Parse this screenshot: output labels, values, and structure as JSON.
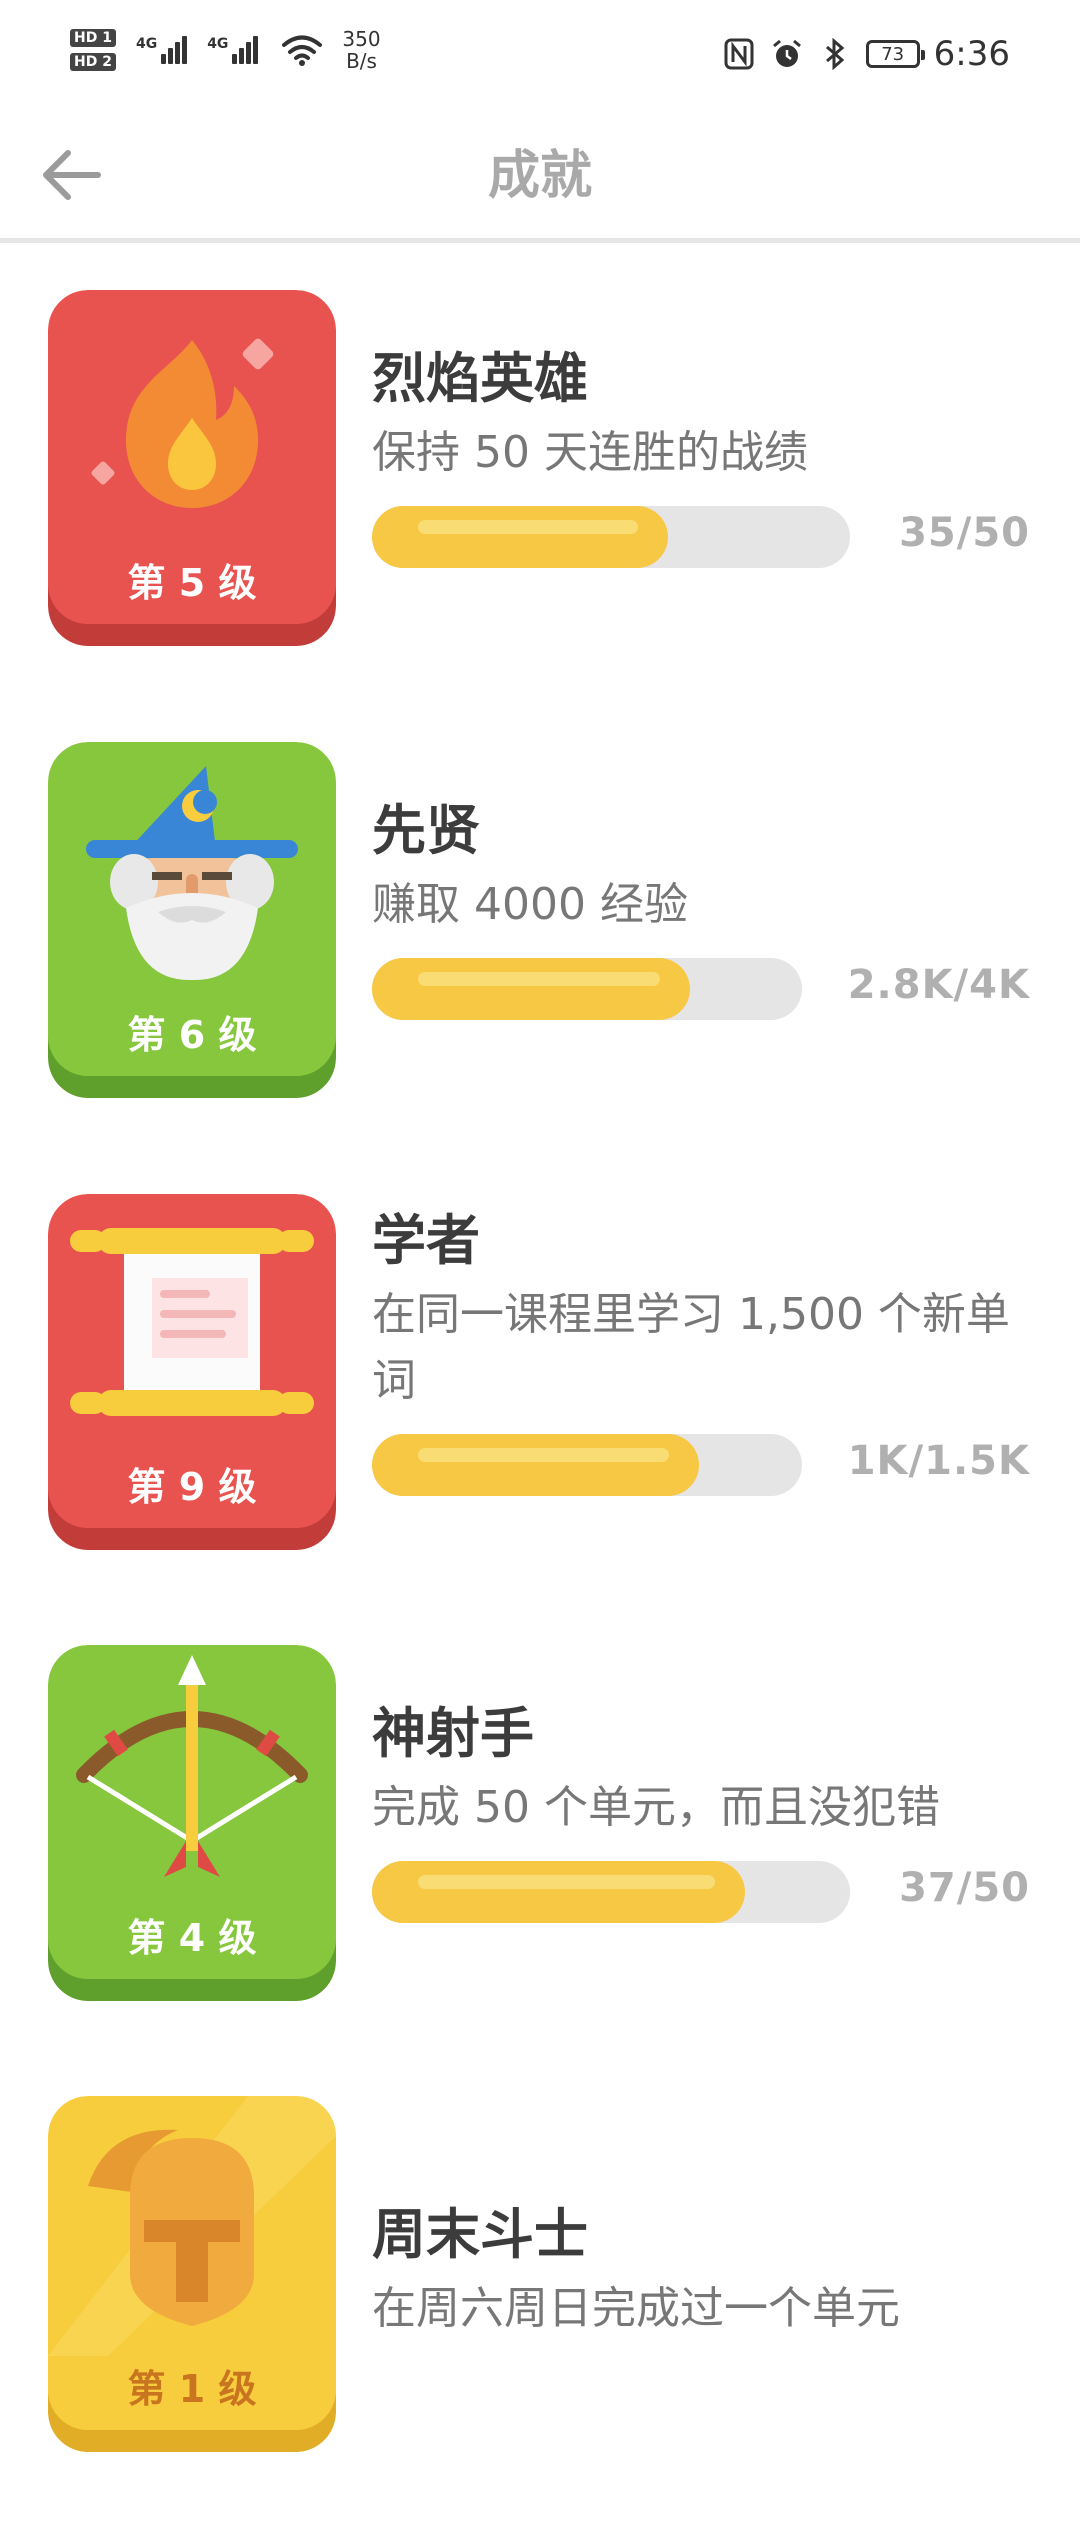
{
  "status": {
    "hd1": "HD 1",
    "hd2": "HD 2",
    "sim1": "4G",
    "sim2": "4G",
    "speed_value": "350",
    "speed_unit": "B/s",
    "battery": "73",
    "time": "6:36"
  },
  "header": {
    "title": "成就"
  },
  "achievements": [
    {
      "title": "烈焰英雄",
      "desc": "保持 50 天连胜的战绩",
      "level": "第 5 级",
      "progress": 0.62,
      "count": "35/50",
      "color": "#e8534f",
      "shade": "#c23d3a",
      "icon": "flame-icon"
    },
    {
      "title": "先贤",
      "desc": "赚取 4000 经验",
      "level": "第 6 级",
      "progress": 0.74,
      "count": "2.8K/4K",
      "color": "#86c73e",
      "shade": "#5f9f2c",
      "icon": "wizard-icon"
    },
    {
      "title": "学者",
      "desc": "在同一课程里学习 1,500 个新单词",
      "level": "第 9 级",
      "progress": 0.76,
      "count": "1K/1.5K",
      "color": "#e8534f",
      "shade": "#c23d3a",
      "icon": "scroll-icon"
    },
    {
      "title": "神射手",
      "desc": "完成 50 个单元，而且没犯错",
      "level": "第 4 级",
      "progress": 0.78,
      "count": "37/50",
      "color": "#86c73e",
      "shade": "#5f9f2c",
      "icon": "bow-arrow-icon"
    },
    {
      "title": "周末斗士",
      "desc": "在周六周日完成过一个单元",
      "level": "第 1 级",
      "color": "#f7cd3e",
      "shade": "#e2ad26",
      "icon": "helmet-icon"
    }
  ]
}
